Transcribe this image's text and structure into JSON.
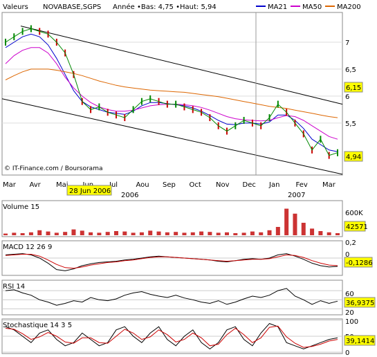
{
  "header": {
    "label": "Valeurs",
    "ticker": "NOVABASE,SGPS",
    "stats": "Année •Bas: 4,75 •Haut: 5,94",
    "legend": [
      {
        "label": "MA21",
        "color": "#0000cc"
      },
      {
        "label": "MA50",
        "color": "#cc00cc"
      },
      {
        "label": "MA200",
        "color": "#dd6600"
      }
    ]
  },
  "watermark": "© IT-Finance.com / Boursorama",
  "chart_data": [
    {
      "type": "line",
      "title": "NOVABASE,SGPS",
      "yticks": [
        "7",
        "6,5",
        "6",
        "5,5"
      ],
      "ylim": [
        4.6,
        7.5
      ],
      "x_months": [
        "Mar",
        "Avr",
        "Mai",
        "Jun",
        "Jul",
        "Aou",
        "Sep",
        "Oct",
        "Nov",
        "Dec",
        "Jan",
        "Fev",
        "Mar"
      ],
      "x_years": [
        "2006",
        "2007"
      ],
      "tooltip_date": "28 Jun 2006",
      "last_price": "4,94",
      "marker_value": "6,15",
      "series": [
        {
          "name": "NOVABASE,SGPS",
          "color": "#008800",
          "values": [
            7.0,
            7.1,
            7.2,
            7.25,
            7.2,
            7.15,
            7.0,
            6.8,
            6.4,
            5.9,
            5.75,
            5.8,
            5.7,
            5.65,
            5.6,
            5.75,
            5.9,
            5.95,
            5.9,
            5.85,
            5.85,
            5.8,
            5.75,
            5.7,
            5.6,
            5.45,
            5.35,
            5.45,
            5.55,
            5.5,
            5.45,
            5.6,
            5.85,
            5.7,
            5.5,
            5.3,
            5.0,
            5.2,
            4.9,
            4.95
          ]
        },
        {
          "name": "MA21",
          "color": "#0000cc",
          "values": [
            6.9,
            7.0,
            7.1,
            7.15,
            7.1,
            6.95,
            6.7,
            6.4,
            6.1,
            5.9,
            5.8,
            5.75,
            5.7,
            5.68,
            5.66,
            5.72,
            5.82,
            5.88,
            5.88,
            5.86,
            5.84,
            5.82,
            5.78,
            5.72,
            5.64,
            5.55,
            5.48,
            5.47,
            5.5,
            5.5,
            5.48,
            5.52,
            5.65,
            5.65,
            5.55,
            5.4,
            5.2,
            5.1,
            5.0,
            4.97
          ]
        },
        {
          "name": "MA50",
          "color": "#cc00cc",
          "values": [
            6.6,
            6.75,
            6.85,
            6.9,
            6.9,
            6.8,
            6.6,
            6.35,
            6.15,
            6.0,
            5.88,
            5.8,
            5.75,
            5.72,
            5.72,
            5.74,
            5.78,
            5.82,
            5.84,
            5.85,
            5.85,
            5.84,
            5.82,
            5.79,
            5.74,
            5.68,
            5.62,
            5.58,
            5.56,
            5.55,
            5.54,
            5.55,
            5.6,
            5.64,
            5.62,
            5.55,
            5.45,
            5.35,
            5.25,
            5.2
          ]
        },
        {
          "name": "MA200",
          "color": "#dd6600",
          "values": [
            6.3,
            6.38,
            6.45,
            6.5,
            6.5,
            6.5,
            6.48,
            6.45,
            6.42,
            6.38,
            6.33,
            6.28,
            6.24,
            6.2,
            6.17,
            6.15,
            6.13,
            6.11,
            6.1,
            6.09,
            6.08,
            6.07,
            6.05,
            6.03,
            6.01,
            5.99,
            5.96,
            5.93,
            5.9,
            5.87,
            5.84,
            5.81,
            5.79,
            5.77,
            5.74,
            5.71,
            5.68,
            5.65,
            5.62,
            5.6
          ]
        }
      ]
    },
    {
      "type": "bar",
      "title": "Volume 15",
      "yticks": [
        "600K"
      ],
      "ylim": [
        0,
        800
      ],
      "last_value": "42571",
      "values": [
        40,
        60,
        50,
        70,
        120,
        90,
        60,
        80,
        140,
        110,
        70,
        60,
        80,
        100,
        90,
        60,
        70,
        110,
        90,
        70,
        80,
        60,
        70,
        90,
        80,
        60,
        70,
        50,
        60,
        90,
        70,
        120,
        200,
        640,
        520,
        300,
        160,
        100,
        70,
        50
      ]
    },
    {
      "type": "line",
      "title": "MACD 12 26 9",
      "yticks": [
        "0,2",
        "0"
      ],
      "ylim": [
        -0.25,
        0.25
      ],
      "last_value": "-0,1286",
      "series": [
        {
          "name": "MACD",
          "color": "#000000",
          "values": [
            0.05,
            0.06,
            0.07,
            0.05,
            0.0,
            -0.08,
            -0.18,
            -0.2,
            -0.17,
            -0.12,
            -0.09,
            -0.07,
            -0.06,
            -0.05,
            -0.03,
            -0.02,
            0.0,
            0.02,
            0.03,
            0.02,
            0.01,
            0.0,
            -0.01,
            -0.02,
            -0.03,
            -0.05,
            -0.06,
            -0.04,
            -0.02,
            -0.01,
            -0.02,
            0.0,
            0.05,
            0.07,
            0.03,
            -0.02,
            -0.08,
            -0.12,
            -0.14,
            -0.13
          ]
        },
        {
          "name": "Signal",
          "color": "#cc0000",
          "values": [
            0.04,
            0.05,
            0.06,
            0.06,
            0.03,
            -0.03,
            -0.1,
            -0.15,
            -0.16,
            -0.14,
            -0.11,
            -0.09,
            -0.07,
            -0.06,
            -0.04,
            -0.03,
            -0.01,
            0.01,
            0.02,
            0.02,
            0.01,
            0.0,
            -0.01,
            -0.02,
            -0.03,
            -0.04,
            -0.05,
            -0.04,
            -0.03,
            -0.02,
            -0.02,
            -0.01,
            0.02,
            0.05,
            0.04,
            0.01,
            -0.04,
            -0.08,
            -0.11,
            -0.12
          ]
        }
      ]
    },
    {
      "type": "line",
      "title": "RSI 14",
      "yticks": [
        "60",
        "40",
        "20"
      ],
      "ylim": [
        10,
        80
      ],
      "last_value": "36,9375",
      "series": [
        {
          "name": "RSI",
          "color": "#000000",
          "values": [
            60,
            62,
            55,
            50,
            40,
            35,
            28,
            32,
            38,
            35,
            45,
            40,
            38,
            42,
            50,
            55,
            58,
            52,
            48,
            45,
            50,
            44,
            40,
            35,
            32,
            38,
            30,
            35,
            42,
            48,
            45,
            50,
            60,
            65,
            48,
            40,
            30,
            38,
            32,
            37
          ]
        }
      ]
    },
    {
      "type": "line",
      "title": "Stochastique 14 3 5",
      "yticks": [
        "100",
        "50",
        "0"
      ],
      "ylim": [
        0,
        100
      ],
      "last_value": "39,1414",
      "series": [
        {
          "name": "%K",
          "color": "#000000",
          "values": [
            80,
            70,
            50,
            30,
            60,
            70,
            40,
            20,
            30,
            60,
            40,
            20,
            30,
            70,
            80,
            50,
            30,
            60,
            80,
            40,
            20,
            50,
            70,
            30,
            10,
            30,
            70,
            80,
            40,
            20,
            60,
            90,
            80,
            30,
            20,
            10,
            20,
            30,
            40,
            45
          ]
        },
        {
          "name": "%D",
          "color": "#cc0000",
          "values": [
            75,
            72,
            58,
            40,
            48,
            62,
            50,
            32,
            28,
            45,
            45,
            30,
            28,
            50,
            72,
            60,
            40,
            48,
            70,
            55,
            32,
            40,
            60,
            45,
            20,
            25,
            55,
            75,
            55,
            30,
            45,
            78,
            82,
            48,
            28,
            15,
            18,
            25,
            35,
            40
          ]
        }
      ]
    }
  ]
}
